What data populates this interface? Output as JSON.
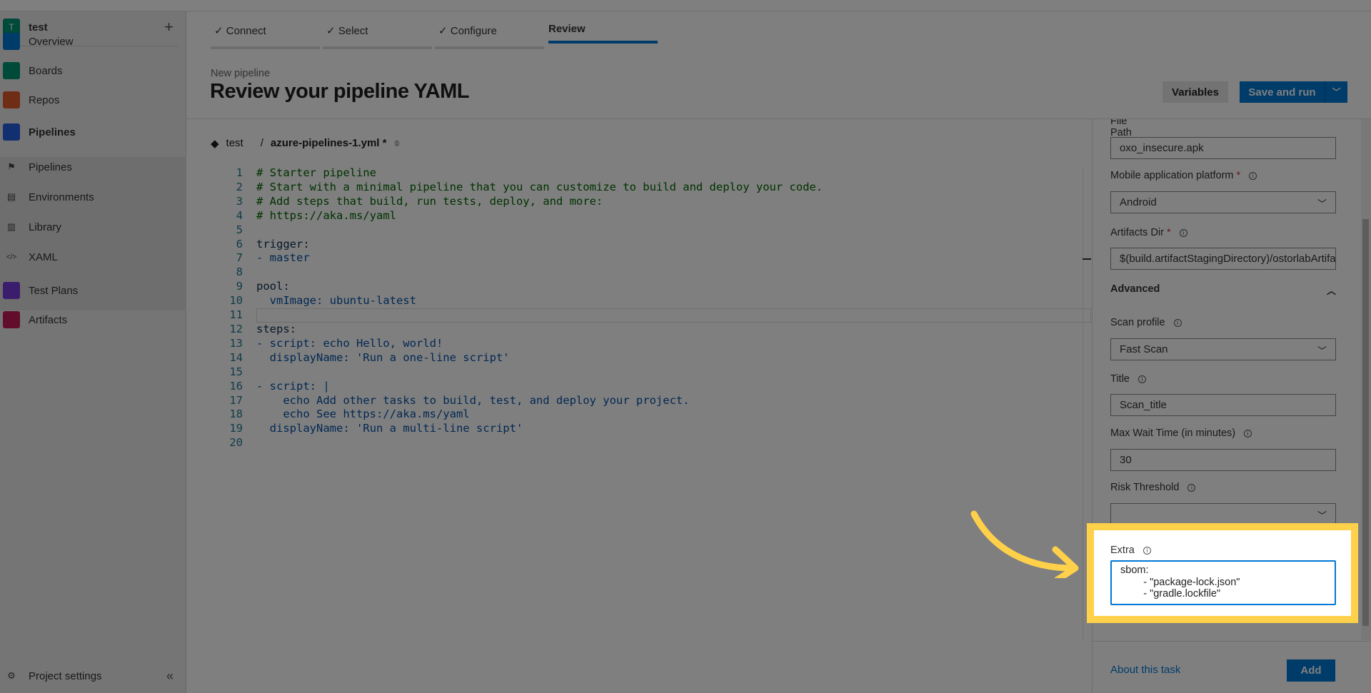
{
  "sidebar": {
    "project": "test",
    "project_initial": "T",
    "items": [
      {
        "label": "Overview",
        "icon": "overview-icon",
        "color": "#0078d4"
      },
      {
        "label": "Boards",
        "icon": "boards-icon",
        "color": "#009473"
      },
      {
        "label": "Repos",
        "icon": "repos-icon",
        "color": "#e05a2b"
      },
      {
        "label": "Pipelines",
        "icon": "pipelines-icon",
        "color": "#2560e0"
      },
      {
        "label": "Pipelines",
        "icon": "pipelines-sub-icon"
      },
      {
        "label": "Environments",
        "icon": "environments-icon"
      },
      {
        "label": "Library",
        "icon": "library-icon"
      },
      {
        "label": "XAML",
        "icon": "code-icon"
      },
      {
        "label": "Test Plans",
        "icon": "test-plans-icon",
        "color": "#773adc"
      },
      {
        "label": "Artifacts",
        "icon": "artifacts-icon",
        "color": "#c61a5a"
      }
    ],
    "settings": "Project settings"
  },
  "wizard": {
    "tabs": [
      "Connect",
      "Select",
      "Configure",
      "Review"
    ],
    "active": "Review"
  },
  "header": {
    "subtitle": "New pipeline",
    "title": "Review your pipeline YAML",
    "variables": "Variables",
    "save_run": "Save and run"
  },
  "file": {
    "repo": "test",
    "separator": "/",
    "name": "azure-pipelines-1.yml *"
  },
  "editor": {
    "lines": [
      "# Starter pipeline",
      "# Start with a minimal pipeline that you can customize to build and deploy your code.",
      "# Add steps that build, run tests, deploy, and more:",
      "# https://aka.ms/yaml",
      "",
      "trigger:",
      "- master",
      "",
      "pool:",
      "  vmImage: ubuntu-latest",
      "",
      "steps:",
      "- script: echo Hello, world!",
      "  displayName: 'Run a one-line script'",
      "",
      "- script: |",
      "    echo Add other tasks to build, test, and deploy your project.",
      "    echo See https://aka.ms/yaml",
      "  displayName: 'Run a multi-line script'",
      ""
    ]
  },
  "panel": {
    "file_path_label": "File Path",
    "file_path": "oxo_insecure.apk",
    "platform_label": "Mobile application platform",
    "platform": "Android",
    "artifacts_label": "Artifacts Dir",
    "artifacts": "$(build.artifactStagingDirectory)/ostorlabArtifacts",
    "advanced": "Advanced",
    "scan_profile_label": "Scan profile",
    "scan_profile": "Fast Scan",
    "title_label": "Title",
    "title": "Scan_title",
    "wait_label": "Max Wait Time (in minutes)",
    "wait": "30",
    "risk_label": "Risk Threshold",
    "risk": "",
    "extra_label": "Extra",
    "extra": "sbom:\n        - \"package-lock.json\"\n        - \"gradle.lockfile\"",
    "about": "About this task",
    "add": "Add"
  },
  "colors": {
    "accent": "#0078d4",
    "highlight": "#ffd04a"
  }
}
